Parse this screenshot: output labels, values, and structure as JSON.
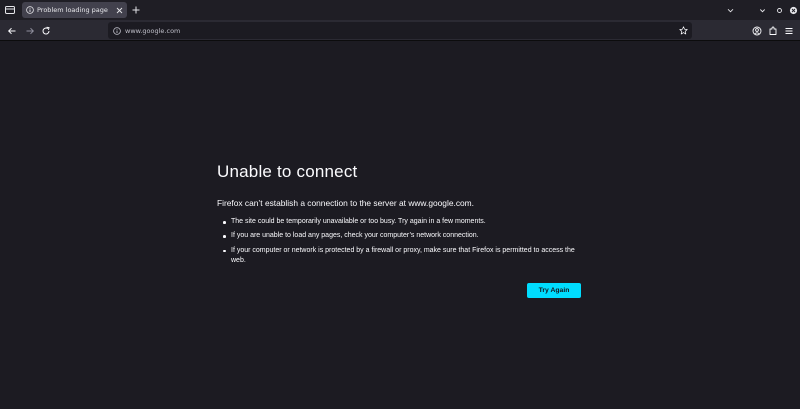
{
  "browser": {
    "tab": {
      "title": "Problem loading page"
    },
    "url": "www.google.com"
  },
  "error_page": {
    "title": "Unable to connect",
    "lead": "Firefox can’t establish a connection to the server at www.google.com.",
    "bullets": [
      "The site could be temporarily unavailable or too busy. Try again in a few moments.",
      "If you are unable to load any pages, check your computer’s network connection.",
      "If your computer or network is protected by a firewall or proxy, make sure that Firefox is permitted to access the web."
    ],
    "button_label": "Try Again"
  },
  "colors": {
    "content_bg": "#1c1b22",
    "toolbar_bg": "#2b2a33",
    "accent_button": "#00ddff"
  },
  "icons": [
    "tab-list-icon",
    "info-icon",
    "tab-close-icon",
    "new-tab-icon",
    "chevron-down-icon",
    "minimize-icon",
    "maximize-icon",
    "close-icon",
    "back-icon",
    "forward-icon",
    "reload-icon",
    "bookmark-star-icon",
    "account-icon",
    "extensions-icon",
    "menu-icon"
  ]
}
